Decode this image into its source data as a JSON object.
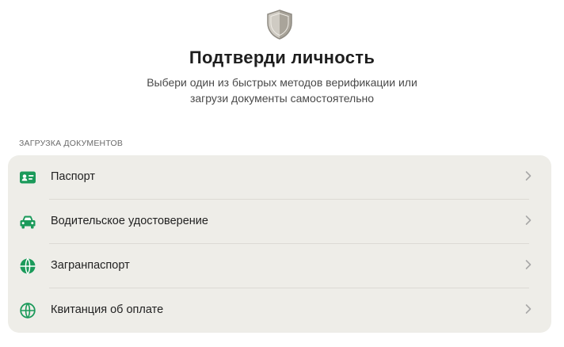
{
  "header": {
    "icon": "shield-icon",
    "title": "Подтверди личность",
    "subtitle_line1": "Выбери один из быстрых методов верификации или",
    "subtitle_line2": "загрузи документы самостоятельно"
  },
  "section": {
    "label": "ЗАГРУЗКА ДОКУМЕНТОВ"
  },
  "documents": [
    {
      "label": "Паспорт",
      "icon": "id-card-icon"
    },
    {
      "label": "Водительское удостоверение",
      "icon": "car-icon"
    },
    {
      "label": "Загранпаспорт",
      "icon": "globe-icon"
    },
    {
      "label": "Квитанция об оплате",
      "icon": "globe-icon"
    }
  ],
  "colors": {
    "accent": "#1b9a5a",
    "list_background": "#eeede8",
    "chevron": "#a8a8a8"
  }
}
